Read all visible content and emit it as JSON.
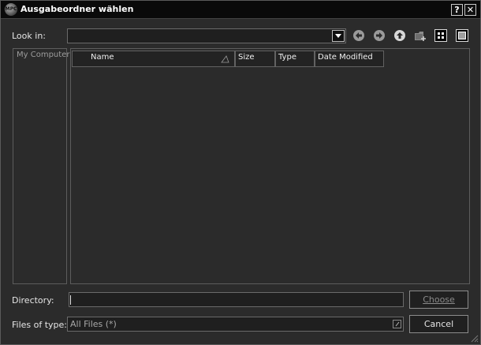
{
  "window": {
    "title": "Ausgabeordner wählen",
    "app_icon_text": "MPC"
  },
  "titlebar": {
    "help_label": "?",
    "close_label": "✕"
  },
  "look_in": {
    "label": "Look in:",
    "value": ""
  },
  "toolbar": {
    "icons": [
      "back-icon",
      "forward-icon",
      "parent-directory-icon",
      "new-folder-icon",
      "list-view-icon",
      "detail-view-icon"
    ]
  },
  "sidebar": {
    "items": [
      {
        "label": "My Computer"
      }
    ]
  },
  "file_list": {
    "columns": [
      {
        "label": "Name"
      },
      {
        "label": "Size"
      },
      {
        "label": "Type"
      },
      {
        "label": "Date Modified"
      }
    ],
    "rows": []
  },
  "directory": {
    "label": "Directory:",
    "value": ""
  },
  "files_of_type": {
    "label": "Files of type:",
    "value": "All Files (*)"
  },
  "buttons": {
    "choose": "Choose",
    "cancel": "Cancel"
  },
  "colors": {
    "background": "#2b2b2b",
    "titlebar": "#0a0a0a",
    "text": "#e6e6e6"
  }
}
